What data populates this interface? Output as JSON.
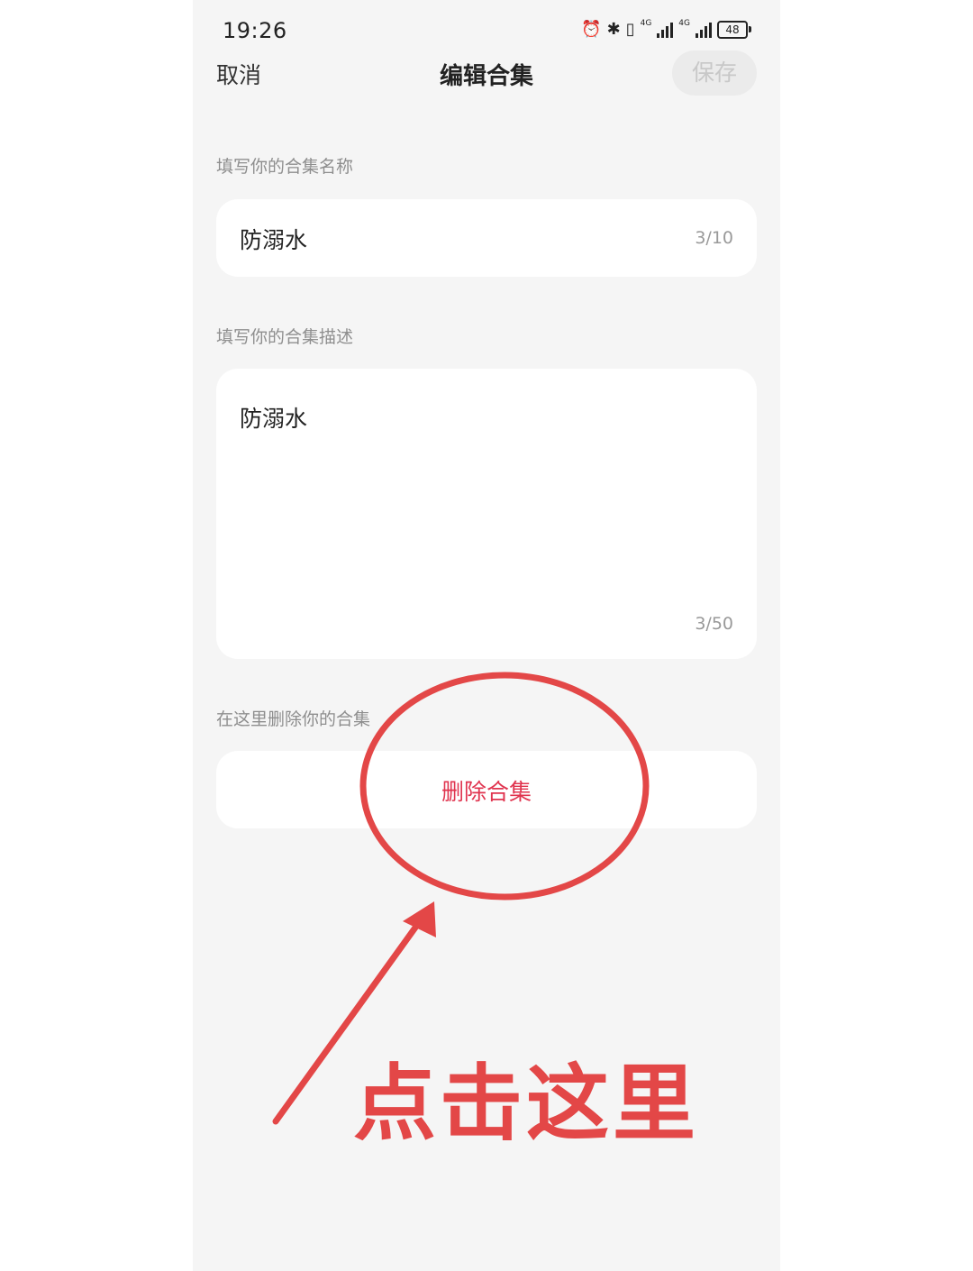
{
  "status_bar": {
    "time": "19:26",
    "net_label_1": "4G",
    "net_label_2": "4G",
    "battery": "48",
    "icons": [
      "alarm-icon",
      "bluetooth-icon",
      "vibrate-icon",
      "signal-icon",
      "signal-icon",
      "battery-icon"
    ]
  },
  "header": {
    "cancel_label": "取消",
    "title": "编辑合集",
    "save_label": "保存"
  },
  "name_section": {
    "label": "填写你的合集名称",
    "value": "防溺水",
    "counter": "3/10"
  },
  "description_section": {
    "label": "填写你的合集描述",
    "value": "防溺水",
    "counter": "3/50"
  },
  "delete_section": {
    "label": "在这里删除你的合集",
    "button_label": "删除合集"
  },
  "annotation": {
    "text": "点击这里",
    "color": "#e34747"
  },
  "colors": {
    "background": "#f5f5f5",
    "card": "#ffffff",
    "delete_text": "#e0344f",
    "save_disabled_text": "#c8c8c8"
  }
}
